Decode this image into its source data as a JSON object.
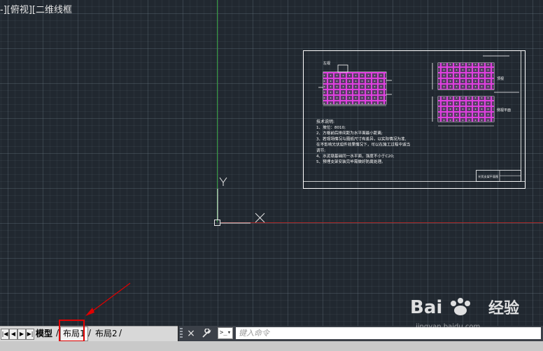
{
  "view_label": "-][俯视][二维线框",
  "ucs": {
    "y_label": "Y",
    "x_label": "X"
  },
  "sheet": {
    "label_left_top": "左视",
    "label_right_top": "顶视",
    "label_right_bottom": "侧视平面",
    "notes_title": "技术说明:",
    "notes": [
      "1、坡位：8010;",
      "2、方格前后排间距为水平面最小距离;",
      "3、若现场情况与图纸尺寸有差异，以实际情况为准,",
      "在不影响光伏组件效果情况下，可以在施工过程中适当",
      "调节;",
      "4、水泥墩基础同一水平面，强度不小于C20;",
      "5、预埋支架安装完毕需做好防腐处理。"
    ],
    "title_block_text": "光伏支架平面图"
  },
  "tabs": {
    "model": "模型",
    "layout1": "布局1",
    "layout2": "布局2"
  },
  "command": {
    "close_icon": "×",
    "wrench_icon": "wrench-icon",
    "placeholder": "键入命令"
  },
  "watermark": {
    "brand": "Bai",
    "brand2": "经验",
    "url": "jingyan.baidu.com"
  },
  "colors": {
    "background": "#212830",
    "panel_magenta": "#e040e0",
    "y_axis": "#2e9a3a",
    "x_axis": "#a82828",
    "highlight": "#e00000"
  }
}
